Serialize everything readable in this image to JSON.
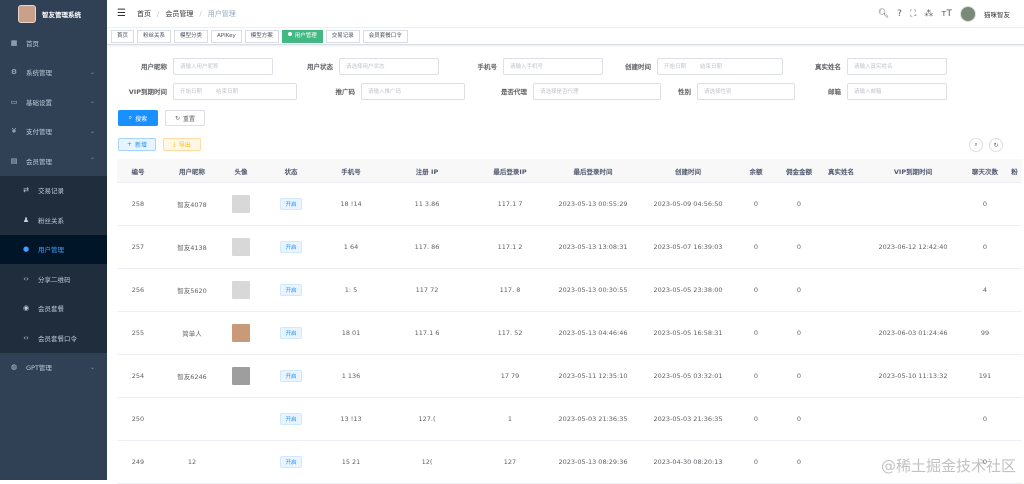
{
  "sidebar": {
    "brand": "智友管理系统",
    "items": [
      {
        "label": "首页",
        "icon": "dashboard-icon"
      },
      {
        "label": "系统管理",
        "icon": "gear-icon",
        "chev": "⌄"
      },
      {
        "label": "基础设置",
        "icon": "monitor-icon",
        "chev": "⌄"
      },
      {
        "label": "支付管理",
        "icon": "yen-icon",
        "chev": "⌄"
      },
      {
        "label": "会员管理",
        "icon": "folder-icon",
        "chev": "⌃"
      }
    ],
    "sub_items": [
      {
        "label": "交易记录"
      },
      {
        "label": "粉丝关系"
      },
      {
        "label": "用户管理"
      },
      {
        "label": "分享二维码"
      },
      {
        "label": "会员套餐"
      },
      {
        "label": "会员套餐口令"
      }
    ],
    "last_item": {
      "label": "GPT管理",
      "chev": "⌄"
    }
  },
  "navbar": {
    "breadcrumbs": [
      "首页",
      "会员管理",
      "用户管理"
    ],
    "sep": "/",
    "user": "猫咪智友"
  },
  "tags": [
    "首页",
    "粉丝关系",
    "模型分类",
    "APIKey",
    "模型方案",
    "用户管理",
    "交易记录",
    "会员套餐口令"
  ],
  "filters": {
    "row1": [
      {
        "label": "用户昵称",
        "placeholder": "请输入用户昵称"
      },
      {
        "label": "用户状态",
        "placeholder": "请选择用户状态"
      },
      {
        "label": "手机号",
        "placeholder": "请输入手机号"
      },
      {
        "label": "创建时间",
        "placeholder": "开始日期",
        "placeholder2": "结束日期"
      },
      {
        "label": "真实姓名",
        "placeholder": "请输入真实姓名"
      }
    ],
    "row2": [
      {
        "label": "VIP到期时间",
        "placeholder": "开始日期",
        "placeholder2": "结束日期"
      },
      {
        "label": "推广码",
        "placeholder": "请输入推广码"
      },
      {
        "label": "是否代理",
        "placeholder": "请选择是否代理"
      },
      {
        "label": "性别",
        "placeholder": "请选择性别"
      },
      {
        "label": "邮箱",
        "placeholder": "请输入邮箱"
      }
    ],
    "search_label": "搜索",
    "reset_label": "重置",
    "add_label": "新增",
    "export_label": "导出"
  },
  "table": {
    "headers": [
      "编号",
      "用户昵称",
      "头像",
      "状态",
      "手机号",
      "注册 IP",
      "最后登录IP",
      "最后登录时间",
      "创建时间",
      "余额",
      "佣金金额",
      "真实姓名",
      "VIP到期时间",
      "聊天次数",
      "粉"
    ],
    "rows": [
      {
        "id": "258",
        "nick": "智友4078",
        "avatar": "blank",
        "status": "开启",
        "phone": "18    !14",
        "reg_ip": "11        3.86",
        "last_ip": "117.1        7",
        "last_login": "2023-05-13 00:55:29",
        "created": "2023-05-09 04:56:50",
        "balance": "0",
        "commission": "0",
        "real_name": "",
        "vip": "",
        "chats": "0"
      },
      {
        "id": "257",
        "nick": "智友4138",
        "avatar": "blank",
        "status": "开启",
        "phone": "1         64",
        "reg_ip": "117.        86",
        "last_ip": "117.1        2",
        "last_login": "2023-05-13 13:08:31",
        "created": "2023-05-07 16:39:03",
        "balance": "0",
        "commission": "0",
        "real_name": "",
        "vip": "2023-06-12 12:42:40",
        "chats": "0"
      },
      {
        "id": "256",
        "nick": "智友5620",
        "avatar": "blank",
        "status": "开启",
        "phone": "1:         5",
        "reg_ip": "117        72",
        "last_ip": "117.        8",
        "last_login": "2023-05-13 00:30:55",
        "created": "2023-05-05 23:38:00",
        "balance": "0",
        "commission": "0",
        "real_name": "",
        "vip": "",
        "chats": "4"
      },
      {
        "id": "255",
        "nick": "简单人",
        "avatar": "face",
        "status": "开启",
        "phone": "18        01",
        "reg_ip": "117.1        6",
        "last_ip": "117.        52",
        "last_login": "2023-05-13 04:46:46",
        "created": "2023-05-05 16:58:31",
        "balance": "0",
        "commission": "0",
        "real_name": "",
        "vip": "2023-06-03 01:24:46",
        "chats": "99"
      },
      {
        "id": "254",
        "nick": "智友6246",
        "avatar": "grey",
        "status": "开启",
        "phone": "1        136",
        "reg_ip": "",
        "last_ip": "17        79",
        "last_login": "2023-05-11 12:35:10",
        "created": "2023-05-05 03:32:01",
        "balance": "0",
        "commission": "0",
        "real_name": "",
        "vip": "2023-05-10 11:13:32",
        "chats": "191"
      },
      {
        "id": "250",
        "nick": "",
        "avatar": "",
        "status": "开启",
        "phone": "13        !13",
        "reg_ip": "127.(",
        "last_ip": "1",
        "last_login": "2023-05-03 21:36:35",
        "created": "2023-05-03 21:36:35",
        "balance": "0",
        "commission": "0",
        "real_name": "",
        "vip": "",
        "chats": "0"
      },
      {
        "id": "249",
        "nick": "12",
        "avatar": "",
        "status": "开启",
        "phone": "15        21",
        "reg_ip": "12(",
        "last_ip": "127",
        "last_login": "2023-05-13 08:29:36",
        "created": "2023-04-30 08:20:13",
        "balance": "0",
        "commission": "0",
        "real_name": "",
        "vip": "",
        "chats": "0"
      }
    ]
  },
  "watermark": "@稀土掘金技术社区"
}
